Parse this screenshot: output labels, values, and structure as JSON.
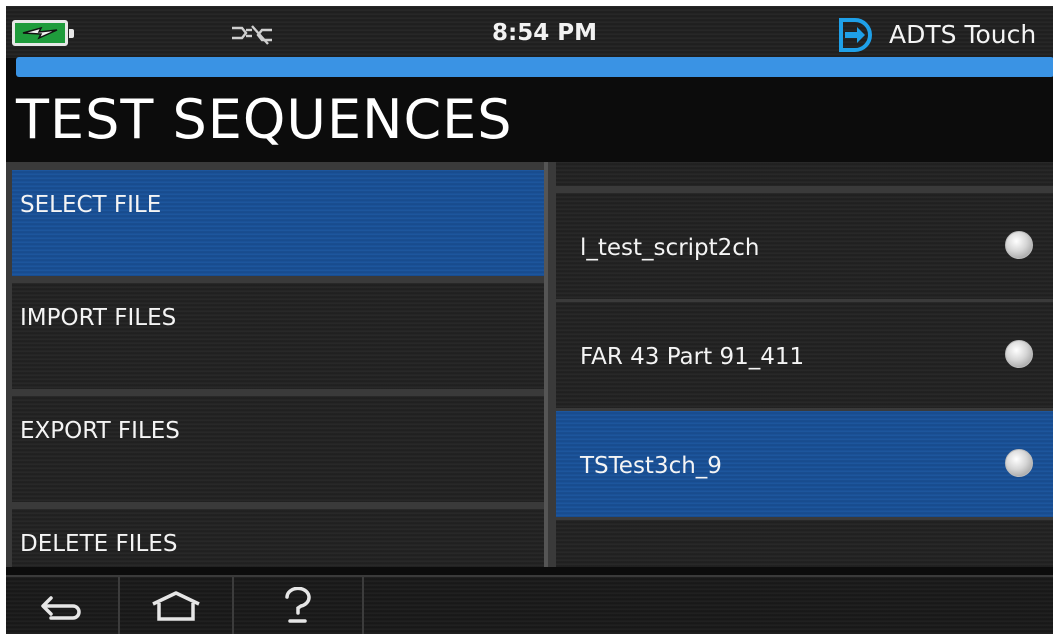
{
  "status": {
    "time": "8:54 PM",
    "brand": "ADTS Touch",
    "battery_icon": "battery-charging-icon",
    "connection_icon": "unplugged-icon",
    "accent_color": "#3a93e4"
  },
  "page": {
    "title": "TEST SEQUENCES"
  },
  "menu": {
    "items": [
      {
        "label": "SELECT FILE",
        "selected": true
      },
      {
        "label": "IMPORT FILES",
        "selected": false
      },
      {
        "label": "EXPORT FILES",
        "selected": false
      },
      {
        "label": "DELETE FILES",
        "selected": false
      }
    ]
  },
  "files": {
    "items": [
      {
        "name": "l_test_script2ch",
        "selected": false
      },
      {
        "name": "FAR 43 Part 91_411",
        "selected": false
      },
      {
        "name": "TSTest3ch_9",
        "selected": true
      }
    ]
  },
  "nav": {
    "buttons": [
      "back-icon",
      "home-icon",
      "help-icon"
    ]
  }
}
